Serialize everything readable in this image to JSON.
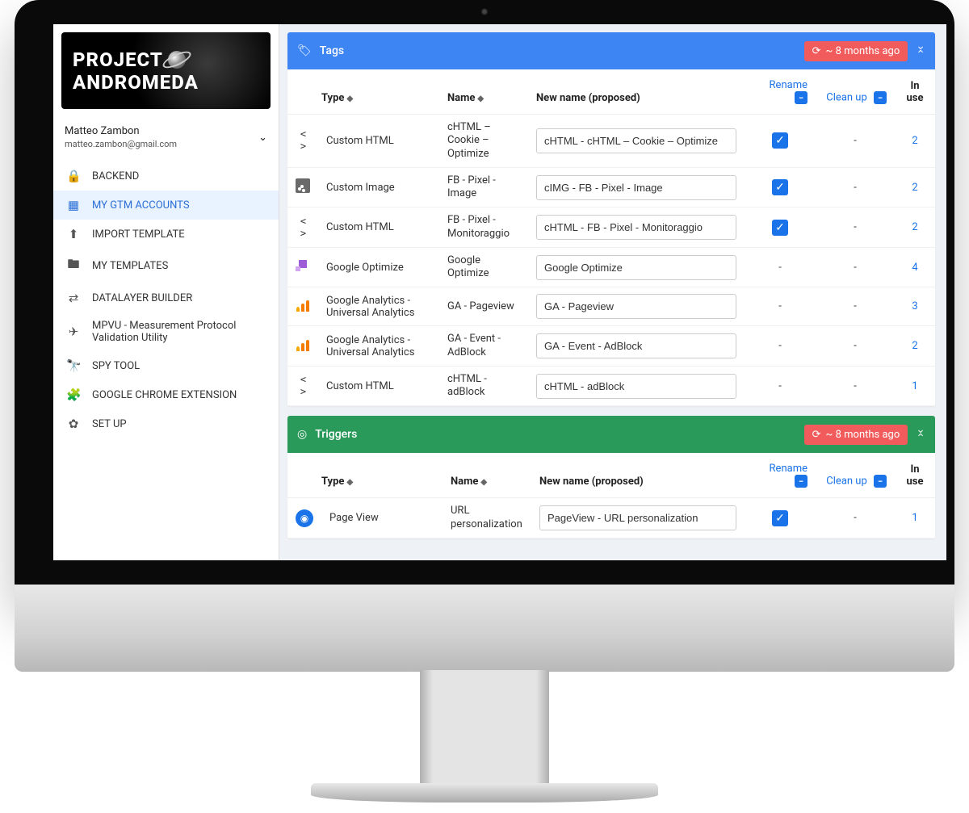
{
  "logo": {
    "line1": "PROJECT",
    "line2": "ANDROMEDA"
  },
  "user": {
    "name": "Matteo Zambon",
    "email": "matteo.zambon@gmail.com"
  },
  "sidebar": {
    "items": [
      {
        "icon": "lock",
        "glyph": "🔒",
        "label": "BACKEND"
      },
      {
        "icon": "grid",
        "glyph": "▦",
        "label": "MY GTM ACCOUNTS",
        "active": true
      },
      {
        "icon": "upload",
        "glyph": "⬆",
        "label": "IMPORT TEMPLATE"
      },
      {
        "icon": "folder",
        "glyph": "🖿",
        "label": "MY TEMPLATES"
      },
      {
        "icon": "transfer",
        "glyph": "⇄",
        "label": "DATALAYER BUILDER"
      },
      {
        "icon": "send",
        "glyph": "✈",
        "label": "MPVU - Measurement Protocol Validation Utility"
      },
      {
        "icon": "binoculars",
        "glyph": "🔭",
        "label": "SPY TOOL"
      },
      {
        "icon": "puzzle",
        "glyph": "🧩",
        "label": "GOOGLE CHROME EXTENSION"
      },
      {
        "icon": "gear",
        "glyph": "✿",
        "label": "SET UP"
      }
    ]
  },
  "panels": {
    "tags": {
      "title": "Tags",
      "refresh_label": "~ 8 months ago",
      "columns": {
        "type": "Type",
        "name": "Name",
        "newname": "New name (proposed)",
        "rename": "Rename",
        "cleanup": "Clean up",
        "inuse": "In use"
      },
      "rows": [
        {
          "icon": "code",
          "type": "Custom HTML",
          "name": "cHTML – Cookie – Optimize",
          "newname": "cHTML - cHTML – Cookie – Optimize",
          "rename": true,
          "cleanup": "-",
          "inuse": "2"
        },
        {
          "icon": "image",
          "type": "Custom Image",
          "name": "FB - Pixel - Image",
          "newname": "cIMG - FB - Pixel - Image",
          "rename": true,
          "cleanup": "-",
          "inuse": "2"
        },
        {
          "icon": "code",
          "type": "Custom HTML",
          "name": "FB - Pixel - Monitoraggio",
          "newname": "cHTML - FB - Pixel - Monitoraggio",
          "rename": true,
          "cleanup": "-",
          "inuse": "2"
        },
        {
          "icon": "optimize",
          "type": "Google Optimize",
          "name": "Google Optimize",
          "newname": "Google Optimize",
          "rename": false,
          "cleanup": "-",
          "inuse": "4"
        },
        {
          "icon": "ga",
          "type": "Google Analytics - Universal Analytics",
          "name": "GA - Pageview",
          "newname": "GA - Pageview",
          "rename": false,
          "cleanup": "-",
          "inuse": "3"
        },
        {
          "icon": "ga",
          "type": "Google Analytics - Universal Analytics",
          "name": "GA - Event - AdBlock",
          "newname": "GA - Event - AdBlock",
          "rename": false,
          "cleanup": "-",
          "inuse": "2"
        },
        {
          "icon": "code",
          "type": "Custom HTML",
          "name": "cHTML - adBlock",
          "newname": "cHTML - adBlock",
          "rename": false,
          "cleanup": "-",
          "inuse": "1"
        }
      ]
    },
    "triggers": {
      "title": "Triggers",
      "refresh_label": "~ 8 months ago",
      "columns": {
        "type": "Type",
        "name": "Name",
        "newname": "New name (proposed)",
        "rename": "Rename",
        "cleanup": "Clean up",
        "inuse": "In use"
      },
      "rows": [
        {
          "icon": "eye",
          "type": "Page View",
          "name": "URL personalization",
          "newname": "PageView - URL personalization",
          "rename": true,
          "cleanup": "-",
          "inuse": "1"
        }
      ]
    }
  }
}
